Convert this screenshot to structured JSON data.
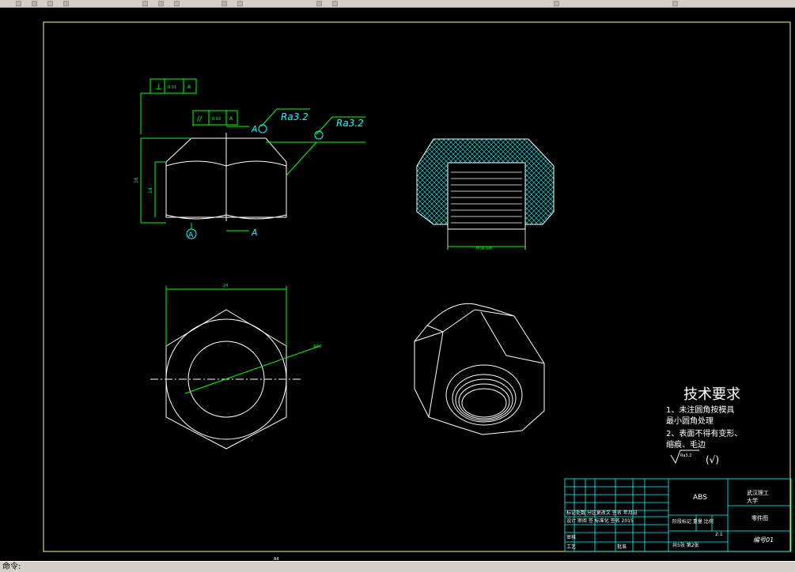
{
  "toolbar": {
    "buttons": [
      "new",
      "open",
      "save",
      "print",
      "cut",
      "copy",
      "paste",
      "undo",
      "redo",
      "pan",
      "zoom",
      "properties",
      "layers"
    ]
  },
  "drawing": {
    "front_view": {
      "gdt_perpendicular": {
        "symbol": "⊥",
        "tolerance": "0.01",
        "datum": "A"
      },
      "gdt_parallel": {
        "symbol": "//",
        "tolerance": "0.02",
        "datum": "A"
      },
      "roughness_1": "Ra3.2",
      "roughness_2": "Ra3.2",
      "section_label_1": "A",
      "section_label_2": "A",
      "datum_label": "A"
    },
    "section_view": {
      "thread_dim": "M16-6H"
    },
    "top_view": {
      "width_dim": "24",
      "diameter_dim": "Φ16"
    },
    "tech_requirements": {
      "title": "技术要求",
      "line1": "1、未注圆角按模具",
      "line2": "最小圆角处理",
      "line3": "2、表面不得有变形、",
      "line4": "缩痕、毛边",
      "ra_symbol": "Ra3.2",
      "other_symbol": "(√)"
    },
    "title_block": {
      "material": "ABS",
      "school": "武汉理工",
      "school2": "大学",
      "drawing_type": "零件图",
      "drawing_no": "编号01",
      "row_mark": "标记处数 分区更改文 签名 年月日",
      "design": "设计 审阅 签 标准化 签名 2015",
      "ratio_label": "阶段标记 重量 比例",
      "ratio": "2:1",
      "sheet_info": "共5张 第2张",
      "row_process": "工艺",
      "row_approve": "批准",
      "check": "审核"
    },
    "sheet_size": "A4"
  },
  "status": {
    "command": "命令:"
  }
}
